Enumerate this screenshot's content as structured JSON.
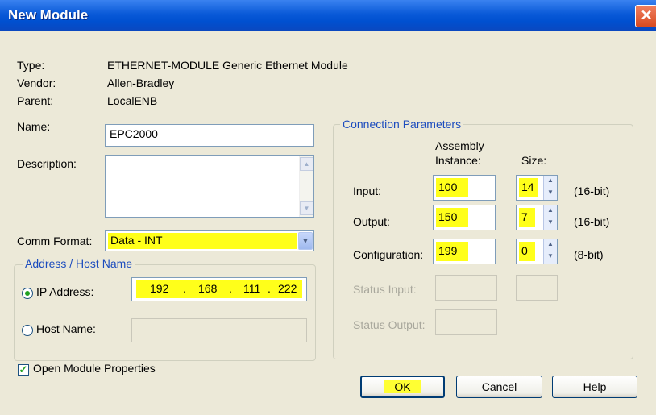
{
  "window": {
    "title": "New Module",
    "close_glyph": "✕"
  },
  "info": {
    "type_label": "Type:",
    "type_value": "ETHERNET-MODULE Generic Ethernet Module",
    "vendor_label": "Vendor:",
    "vendor_value": "Allen-Bradley",
    "parent_label": "Parent:",
    "parent_value": "LocalENB"
  },
  "name": {
    "label": "Name:",
    "value": "EPC2000"
  },
  "description": {
    "label": "Description:",
    "value": ""
  },
  "comm_format": {
    "label": "Comm Format:",
    "value": "Data - INT"
  },
  "address": {
    "group_title": "Address / Host Name",
    "ip_label": "IP Address:",
    "ip_octets": [
      "192",
      "168",
      "111",
      "222"
    ],
    "ip_separator": ".",
    "host_label": "Host Name:",
    "host_value": "",
    "selected": "ip"
  },
  "connection": {
    "group_title": "Connection Parameters",
    "col_assembly_line1": "Assembly",
    "col_assembly_line2": "Instance:",
    "col_size": "Size:",
    "rows": [
      {
        "label": "Input:",
        "instance": "100",
        "size": "14",
        "unit": "(16-bit)"
      },
      {
        "label": "Output:",
        "instance": "150",
        "size": "7",
        "unit": "(16-bit)"
      },
      {
        "label": "Configuration:",
        "instance": "199",
        "size": "0",
        "unit": "(8-bit)"
      }
    ],
    "status_input_label": "Status Input:",
    "status_output_label": "Status Output:"
  },
  "footer": {
    "open_props_label": "Open Module Properties",
    "open_props_checked": true,
    "ok_label": "OK",
    "cancel_label": "Cancel",
    "help_label": "Help"
  },
  "colors": {
    "highlight": "#ffff1a",
    "title_bar": "#0a5ad8",
    "group_title": "#1c4cbe",
    "dialog_bg": "#ece9d8"
  }
}
